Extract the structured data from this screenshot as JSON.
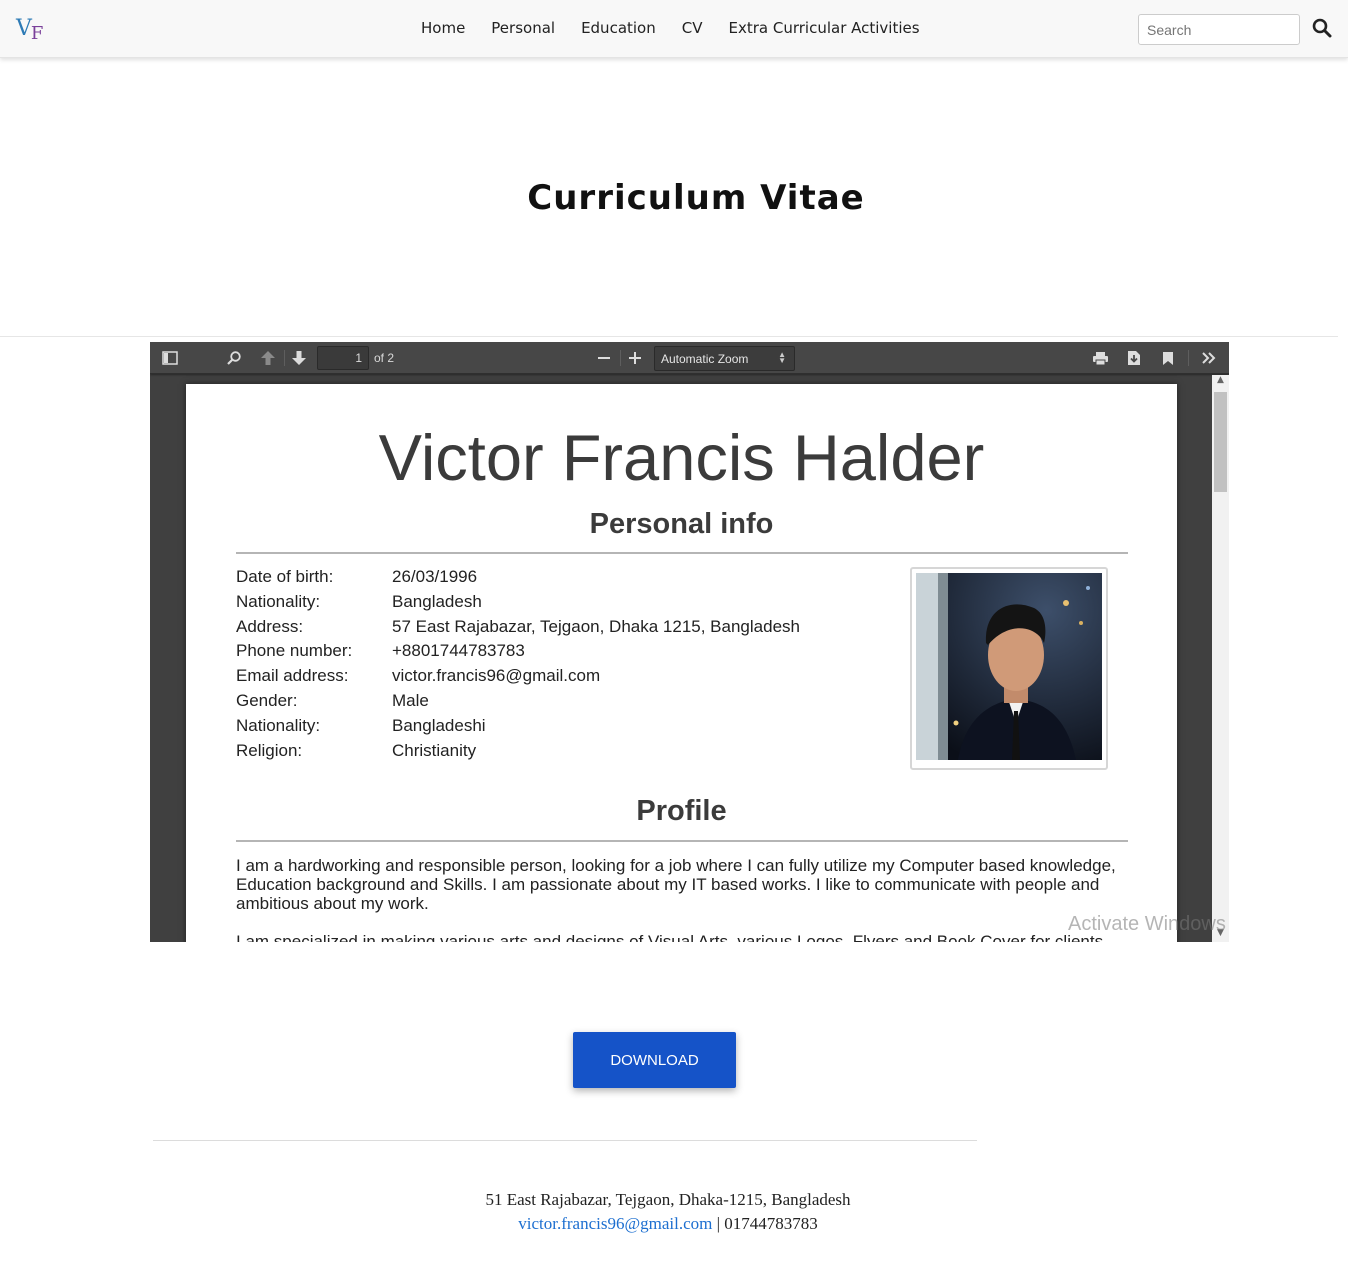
{
  "navbar": {
    "brand_v": "V",
    "brand_f": "F",
    "links": [
      "Home",
      "Personal",
      "Education",
      "CV",
      "Extra Curricular Activities"
    ],
    "search_placeholder": "Search",
    "search_icon": "search-icon"
  },
  "page_title": "Curriculum Vitae",
  "pdf_viewer": {
    "page_number": "1",
    "page_count_label": "of 2",
    "zoom": "Automatic Zoom",
    "toolbar_icons": [
      "sidebar-toggle-icon",
      "find-icon",
      "previous-page-icon",
      "next-page-icon",
      "zoom-out-icon",
      "zoom-in-icon",
      "print-icon",
      "download-icon",
      "bookmark-icon",
      "tools-icon"
    ],
    "document": {
      "name": "Victor Francis Halder",
      "personal_heading": "Personal info",
      "info": [
        {
          "label": "Date of birth:",
          "value": "26/03/1996"
        },
        {
          "label": "Nationality:",
          "value": "Bangladesh"
        },
        {
          "label": "Address:",
          "value": "57 East Rajabazar, Tejgaon, Dhaka 1215, Bangladesh"
        },
        {
          "label": "Phone number:",
          "value": "+8801744783783"
        },
        {
          "label": "Email address:",
          "value": "victor.francis96@gmail.com"
        },
        {
          "label": "Gender:",
          "value": "Male"
        },
        {
          "label": "Nationality:",
          "value": "Bangladeshi"
        },
        {
          "label": "Religion:",
          "value": "Christianity"
        }
      ],
      "profile_heading": "Profile",
      "profile_paragraphs": [
        "I am a hardworking and responsible person, looking for a job where I can fully utilize my Computer based knowledge, Education background and Skills. I am passionate about my IT based works. I like to communicate with people and ambitious about my work.",
        "I am specialized in making various arts and designs of Visual Arts, various Logos, Flyers and Book Cover for clients."
      ]
    },
    "watermark": "Activate Windows"
  },
  "download_label": "DOWNLOAD",
  "footer": {
    "address": "51 East Rajabazar, Tejgaon, Dhaka-1215, Bangladesh",
    "email": "victor.francis96@gmail.com",
    "separator_phone": " | 01744783783"
  },
  "colors": {
    "brand_v": "#2e7bb6",
    "brand_f": "#7a3f9a",
    "download_button": "#1553c8",
    "footer_link": "#1d6fd0",
    "viewer_background": "#404040"
  }
}
